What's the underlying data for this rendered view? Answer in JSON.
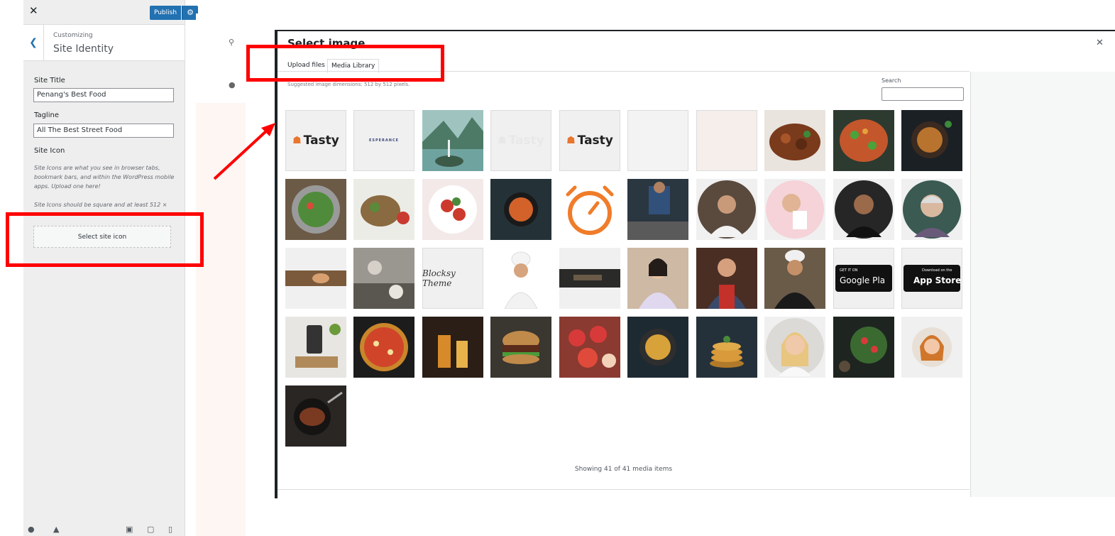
{
  "customizer": {
    "close_icon": "close-icon",
    "publish_label": "Publish",
    "settings_icon": "gear-icon",
    "back_icon": "chevron-left-icon",
    "breadcrumb": "Customizing",
    "section_title": "Site Identity",
    "site_title_label": "Site Title",
    "site_title_value": "Penang's Best Food",
    "tagline_label": "Tagline",
    "tagline_value": "All The Best Street Food",
    "site_icon_label": "Site Icon",
    "site_icon_help": "Site Icons are what you see in browser tabs, bookmark bars, and within the WordPress mobile apps. Upload one here!",
    "site_icon_size_help": "Site Icons should be square and at least 512 ×",
    "select_icon_button": "Select site icon"
  },
  "modal": {
    "title": "Select image",
    "close_icon": "close-icon",
    "tabs": [
      "Upload files",
      "Media Library"
    ],
    "active_tab": "Media Library",
    "suggested": "Suggested image dimensions: 512 by 512 pixels.",
    "search_label": "Search",
    "search_value": "",
    "showing": "Showing 41 of 41 media items",
    "library_texts": {
      "tasty": "Tasty",
      "google_small": "GET IT ON",
      "google_big": "Google Pla",
      "apple_small": "Download on the",
      "apple_big": "App Store",
      "script": "Blocksy Theme",
      "tiny_logo": "ESPERANCE"
    }
  },
  "colors": {
    "accent": "#2271b1",
    "annotation_red": "#ff0000"
  }
}
